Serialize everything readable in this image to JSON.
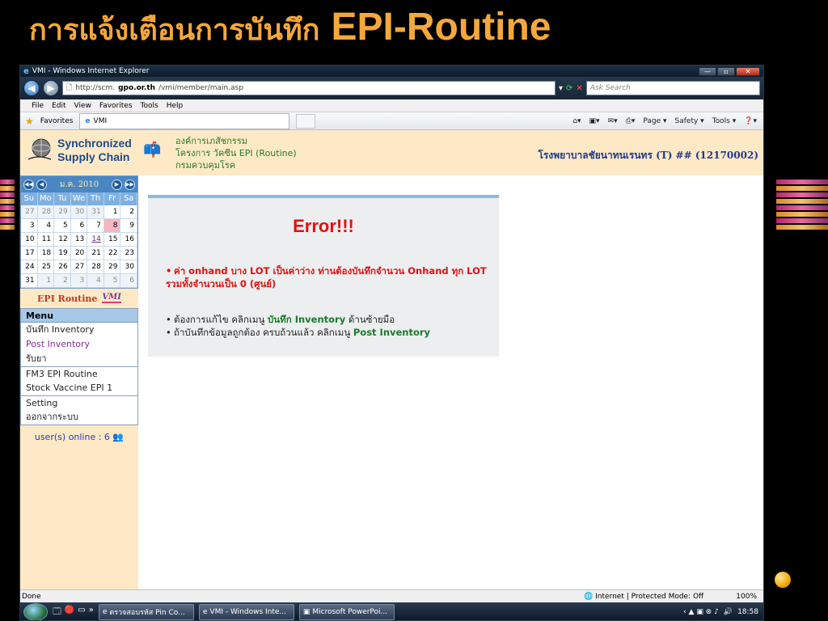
{
  "slide": {
    "title_th": "การแจ้งเตือนการบันทึก",
    "title_en": "EPI-Routine"
  },
  "browser": {
    "window_title": "VMI - Windows Internet Explorer",
    "url_prefix": "http://scm.",
    "url_domain": "gpo.or.th",
    "url_path": "/vmi/member/main.asp",
    "search_placeholder": "Ask Search",
    "menu": [
      "File",
      "Edit",
      "View",
      "Favorites",
      "Tools",
      "Help"
    ],
    "favorites_label": "Favorites",
    "tab_label": "VMI",
    "cmd": [
      "Page ▾",
      "Safety ▾",
      "Tools ▾"
    ],
    "status": "Done",
    "zone": "Internet | Protected Mode: Off",
    "zoom": "100%"
  },
  "site": {
    "logo_line1": "Synchronized",
    "logo_line2": "Supply Chain",
    "org_line1": "องค์การเภสัชกรรม",
    "org_line2": "โครงการ วัคซีน EPI (Routine)",
    "org_line3": "กรมควบคุมโรค",
    "hospital": "โรงพยาบาลชัยนาทนเรนทร (T) ## (12170002)"
  },
  "calendar": {
    "month_label": "ม.ค. 2010",
    "dow": [
      "Su",
      "Mo",
      "Tu",
      "We",
      "Th",
      "Fr",
      "Sa"
    ],
    "weeks": [
      [
        27,
        28,
        29,
        30,
        31,
        1,
        2
      ],
      [
        3,
        4,
        5,
        6,
        7,
        8,
        9
      ],
      [
        10,
        11,
        12,
        13,
        14,
        15,
        16
      ],
      [
        17,
        18,
        19,
        20,
        21,
        22,
        23
      ],
      [
        24,
        25,
        26,
        27,
        28,
        29,
        30
      ],
      [
        31,
        1,
        2,
        3,
        4,
        5,
        6
      ]
    ],
    "today": 8,
    "linked": 14
  },
  "sidebar": {
    "epi_label": "EPI Routine",
    "vmi_mark": "VMI",
    "menu_title": "Menu",
    "items": [
      "บันทึก Inventory",
      "Post Inventory",
      "รับยา",
      "FM3 EPI Routine",
      "Stock Vaccine EPI 1",
      "Setting",
      "ออกจากระบบ"
    ],
    "users_online": "user(s) online : 6"
  },
  "content": {
    "error_title": "Error!!!",
    "error_message": "ค่า onhand บาง LOT เป็นค่าว่าง ท่านต้องบันทึกจำนวน Onhand ทุก LOT รวมทั้งจำนวนเป็น 0 (ศูนย์)",
    "tip1_a": "ต้องการแก้ไข คลิกเมนู",
    "tip1_link": "บันทึก Inventory",
    "tip1_b": "ด้านซ้ายมือ",
    "tip2_a": "ถ้าบันทึกข้อมูลถูกต้อง ครบถ้วนแล้ว คลิกเมนู",
    "tip2_link": "Post Inventory"
  },
  "taskbar": [
    "ตรวจสอบรหัส Pin Co...",
    "VMI - Windows Inte...",
    "Microsoft PowerPoi...",
    "18:58"
  ],
  "taskbar_clock_note": null
}
